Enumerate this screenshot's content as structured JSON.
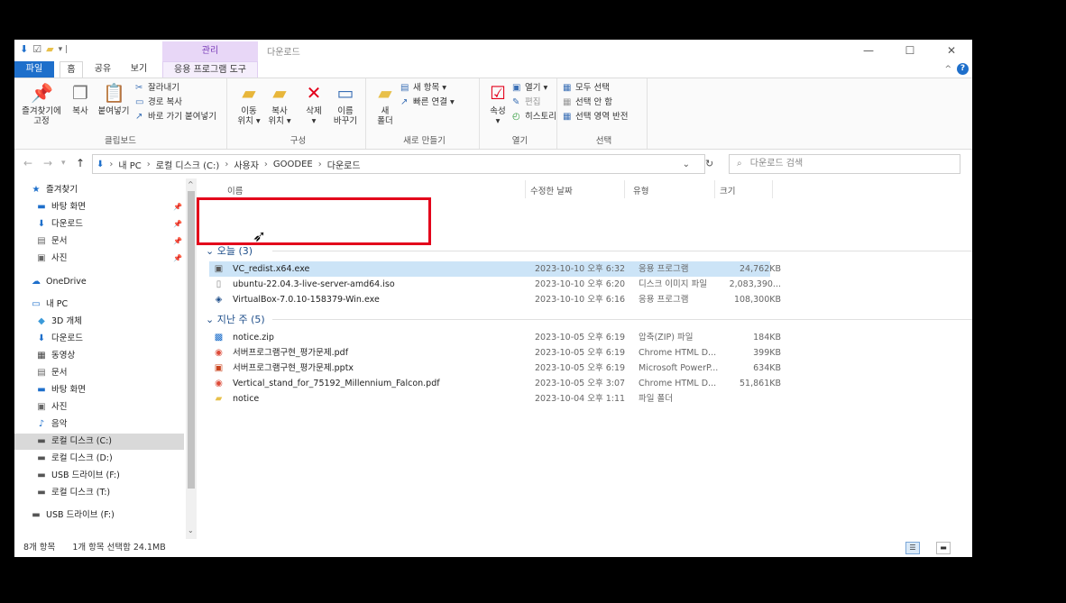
{
  "titlebar": {
    "manage_tab": "관리",
    "title": "다운로드",
    "minimize": "—",
    "maximize": "☐",
    "close": "✕"
  },
  "tabs": {
    "file": "파일",
    "home": "홈",
    "share": "공유",
    "view": "보기",
    "app_tools": "응용 프로그램 도구"
  },
  "ribbon": {
    "clipboard": {
      "label": "클립보드",
      "pin_label": "즐겨찾기에\n고정",
      "copy_label": "복사",
      "paste_label": "붙여넣기",
      "cut_label": "잘라내기",
      "copy_path_label": "경로 복사",
      "paste_shortcut_label": "바로 가기 붙여넣기"
    },
    "organize": {
      "label": "구성",
      "move_to_label": "이동\n위치 ▾",
      "copy_to_label": "복사\n위치 ▾",
      "delete_label": "삭제\n▾",
      "rename_label": "이름\n바꾸기"
    },
    "new": {
      "label": "새로 만들기",
      "new_folder_label": "새\n폴더",
      "new_item_label": "새 항목 ▾",
      "easy_access_label": "빠른 연결 ▾"
    },
    "open": {
      "label": "열기",
      "properties_label": "속성\n▾",
      "open_label": "열기 ▾",
      "edit_label": "편집",
      "history_label": "히스토리"
    },
    "select": {
      "label": "선택",
      "select_all_label": "모두 선택",
      "select_none_label": "선택 안 함",
      "invert_label": "선택 영역 반전"
    }
  },
  "address": {
    "path": [
      "내 PC",
      "로컬 디스크 (C:)",
      "사용자",
      "GOODEE",
      "다운로드"
    ],
    "search_placeholder": "다운로드 검색"
  },
  "nav": {
    "items": [
      {
        "label": "즐겨찾기",
        "icon": "★",
        "color": "#1e6fcb",
        "indent": 0,
        "pin": false
      },
      {
        "label": "바탕 화면",
        "icon": "▬",
        "color": "#1e6fcb",
        "indent": 1,
        "pin": true
      },
      {
        "label": "다운로드",
        "icon": "⬇",
        "color": "#1e6fcb",
        "indent": 1,
        "pin": true
      },
      {
        "label": "문서",
        "icon": "▤",
        "color": "#666666",
        "indent": 1,
        "pin": true
      },
      {
        "label": "사진",
        "icon": "▣",
        "color": "#666666",
        "indent": 1,
        "pin": true
      },
      {
        "label": "OneDrive",
        "icon": "☁",
        "color": "#1e6fcb",
        "indent": 0,
        "pin": false
      },
      {
        "label": "내 PC",
        "icon": "▭",
        "color": "#1e6fcb",
        "indent": 0,
        "pin": false
      },
      {
        "label": "3D 개체",
        "icon": "◆",
        "color": "#3a9ad9",
        "indent": 1,
        "pin": false
      },
      {
        "label": "다운로드",
        "icon": "⬇",
        "color": "#1e6fcb",
        "indent": 1,
        "pin": false
      },
      {
        "label": "동영상",
        "icon": "▦",
        "color": "#444444",
        "indent": 1,
        "pin": false
      },
      {
        "label": "문서",
        "icon": "▤",
        "color": "#666666",
        "indent": 1,
        "pin": false
      },
      {
        "label": "바탕 화면",
        "icon": "▬",
        "color": "#1e6fcb",
        "indent": 1,
        "pin": false
      },
      {
        "label": "사진",
        "icon": "▣",
        "color": "#666666",
        "indent": 1,
        "pin": false
      },
      {
        "label": "음악",
        "icon": "♪",
        "color": "#1e6fcb",
        "indent": 1,
        "pin": false
      },
      {
        "label": "로컬 디스크 (C:)",
        "icon": "▬",
        "color": "#555555",
        "indent": 1,
        "pin": false,
        "selected": true
      },
      {
        "label": "로컬 디스크 (D:)",
        "icon": "▬",
        "color": "#555555",
        "indent": 1,
        "pin": false
      },
      {
        "label": "USB 드라이브 (F:)",
        "icon": "▬",
        "color": "#555555",
        "indent": 1,
        "pin": false
      },
      {
        "label": "로컬 디스크 (T:)",
        "icon": "▬",
        "color": "#555555",
        "indent": 1,
        "pin": false
      },
      {
        "label": "USB 드라이브 (F:)",
        "icon": "▬",
        "color": "#555555",
        "indent": 0,
        "pin": false
      }
    ]
  },
  "columns": {
    "name": "이름",
    "date": "수정한 날짜",
    "type": "유형",
    "size": "크기"
  },
  "groups": [
    {
      "title": "오늘 (3)",
      "files": [
        {
          "name": "VC_redist.x64.exe",
          "date": "2023-10-10 오후 6:32",
          "type": "응용 프로그램",
          "size": "24,762KB",
          "icon": "▣",
          "color": "#5a5a5a",
          "selected": true
        },
        {
          "name": "ubuntu-22.04.3-live-server-amd64.iso",
          "date": "2023-10-10 오후 6:20",
          "type": "디스크 이미지 파일",
          "size": "2,083,390...",
          "icon": "▯",
          "color": "#888888",
          "selected": false
        },
        {
          "name": "VirtualBox-7.0.10-158379-Win.exe",
          "date": "2023-10-10 오후 6:16",
          "type": "응용 프로그램",
          "size": "108,300KB",
          "icon": "◈",
          "color": "#1e4e8a",
          "selected": false
        }
      ]
    },
    {
      "title": "지난 주 (5)",
      "files": [
        {
          "name": "notice.zip",
          "date": "2023-10-05 오후 6:19",
          "type": "압축(ZIP) 파일",
          "size": "184KB",
          "icon": "▩",
          "color": "#1e6fcb",
          "selected": false
        },
        {
          "name": "서버프로그램구현_평가문제.pdf",
          "date": "2023-10-05 오후 6:19",
          "type": "Chrome HTML D...",
          "size": "399KB",
          "icon": "◉",
          "color": "#dd4b39",
          "selected": false
        },
        {
          "name": "서버프로그램구현_평가문제.pptx",
          "date": "2023-10-05 오후 6:19",
          "type": "Microsoft PowerP...",
          "size": "634KB",
          "icon": "▣",
          "color": "#c9431c",
          "selected": false
        },
        {
          "name": "Vertical_stand_for_75192_Millennium_Falcon.pdf",
          "date": "2023-10-05 오후 3:07",
          "type": "Chrome HTML D...",
          "size": "51,861KB",
          "icon": "◉",
          "color": "#dd4b39",
          "selected": false
        },
        {
          "name": "notice",
          "date": "2023-10-04 오후 1:11",
          "type": "파일 폴더",
          "size": "",
          "icon": "▰",
          "color": "#e8c04a",
          "selected": false
        }
      ]
    }
  ],
  "status": {
    "item_count": "8개 항목",
    "selection": "1개 항목 선택함 24.1MB"
  }
}
